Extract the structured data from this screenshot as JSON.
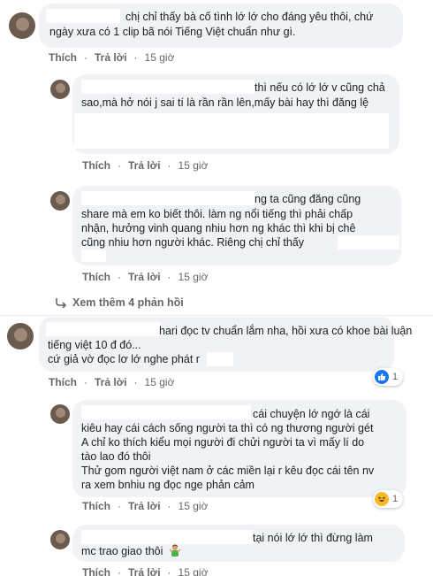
{
  "comments": [
    {
      "lines": [
        "chị chỉ thấy bà cố tình lớ lớ cho đáng yêu thôi, chứ",
        "ngày xưa có 1 clip bã nói Tiếng Việt chuẩn như gì."
      ],
      "like": "Thích",
      "reply": "Trả lời",
      "time": "15 giờ"
    },
    {
      "lines": [
        "thì nếu có lớ lớ v cũng chả",
        "sao,mà hở nói j sai tí là rần rần lên,mấy bài hay thì đăng lệ"
      ],
      "like": "Thích",
      "reply": "Trả lời",
      "time": "15 giờ"
    },
    {
      "lines": [
        "ng ta cũng đăng cũng",
        "share mà em ko biết thôi. làm ng nổi tiếng thì phải chấp",
        "nhận, hưởng vinh quang nhiu hơn ng khác thì khi bị chê",
        "cũng nhiu hơn người khác. Riêng chị chỉ thấy"
      ],
      "like": "Thích",
      "reply": "Trả lời",
      "time": "15 giờ"
    },
    {
      "lines": [
        "hari đọc tv chuẩn lắm nha, hồi xưa có khoe bài luận",
        "tiếng việt 10 đ đó...",
        "cứ giả vờ đọc lơ lớ nghe phát r"
      ],
      "like": "Thích",
      "reply": "Trả lời",
      "time": "15 giờ",
      "reaction_count": "1"
    },
    {
      "lines": [
        "cái chuyện lớ ngớ là cái",
        "kiêu hay cái cách sống người ta thì có ng thương người gét",
        "A chỉ ko thích kiểu mọi người đi chửi người ta vì mấy lí do",
        "tào lao đó thôi",
        "Thử gom người việt nam ở các miền lại r kêu đọc cái tên nv",
        "ra xem bnhiu ng đọc nge phản cảm"
      ],
      "like": "Thích",
      "reply": "Trả lời",
      "time": "15 giờ",
      "reaction_count": "1"
    },
    {
      "lines": [
        "tại nói lớ lớ thì đừng làm",
        "mc trao giao thôi"
      ],
      "like": "Thích",
      "reply": "Trả lời",
      "time": "15 giờ"
    }
  ],
  "more_replies": "Xem thêm 4 phản hồi",
  "colors": {
    "bubble": "#f0f2f5",
    "link": "#65676b",
    "like_blue": "#1877f2",
    "haha_yellow": "#f7b928"
  },
  "icons": [
    "like-icon",
    "haha-icon",
    "reply-arrow-icon",
    "man-gesturing-emoji"
  ]
}
